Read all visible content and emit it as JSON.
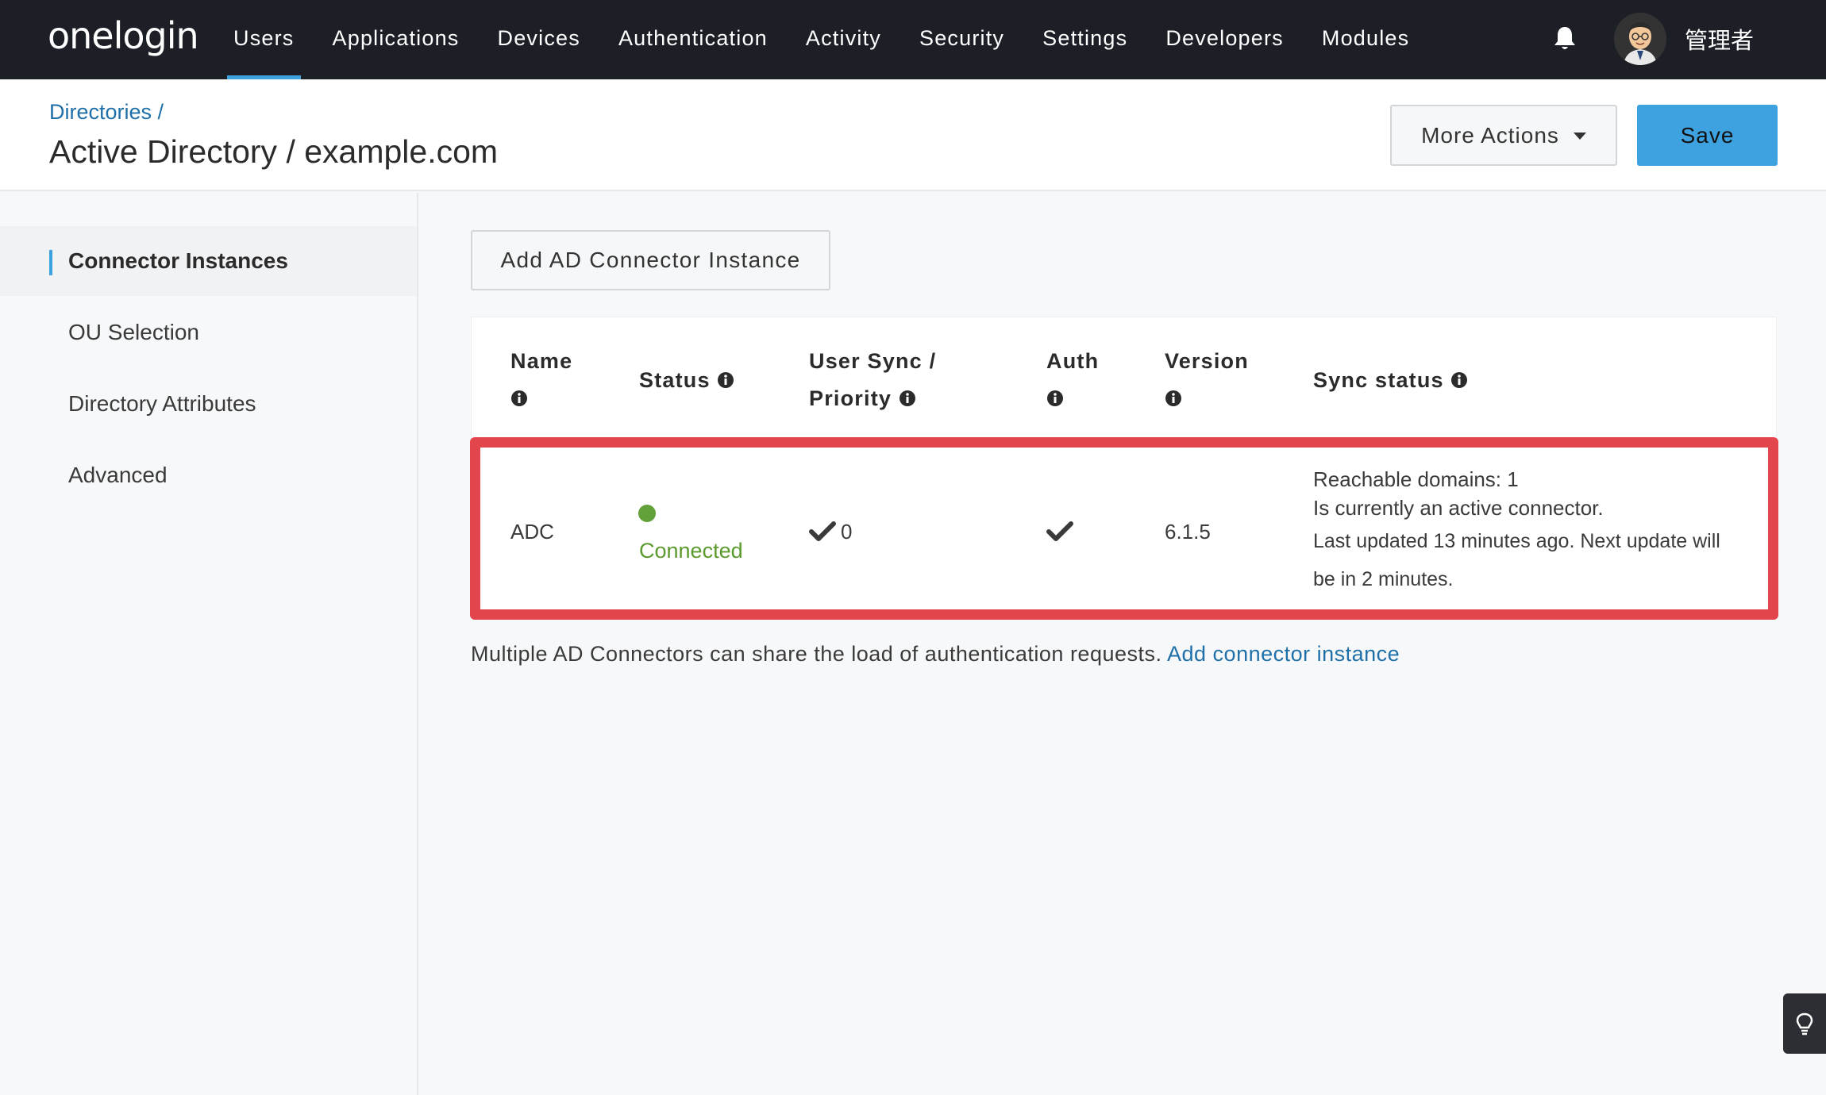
{
  "nav": {
    "logo": "onelogin",
    "items": [
      {
        "label": "Users"
      },
      {
        "label": "Applications"
      },
      {
        "label": "Devices"
      },
      {
        "label": "Authentication"
      },
      {
        "label": "Activity"
      },
      {
        "label": "Security"
      },
      {
        "label": "Settings"
      },
      {
        "label": "Developers"
      },
      {
        "label": "Modules"
      }
    ],
    "active_item": "Users",
    "user_name": "管理者",
    "bell_icon": "bell-icon"
  },
  "header": {
    "breadcrumb": "Directories",
    "breadcrumb_sep": " /",
    "title": "Active Directory / example.com",
    "more_actions_label": "More Actions",
    "save_label": "Save"
  },
  "sidebar": {
    "items": [
      {
        "label": "Connector Instances"
      },
      {
        "label": "OU Selection"
      },
      {
        "label": "Directory Attributes"
      },
      {
        "label": "Advanced"
      }
    ],
    "active_item": "Connector Instances"
  },
  "main": {
    "add_button_label": "Add AD Connector Instance",
    "table": {
      "headers": {
        "name": "Name",
        "status": "Status",
        "user_sync_line1": "User Sync /",
        "user_sync_line2": "Priority",
        "auth": "Auth",
        "version": "Version",
        "sync_status": "Sync status"
      },
      "rows": [
        {
          "name": "ADC",
          "status": "Connected",
          "user_sync_checked": true,
          "priority": "0",
          "auth_checked": true,
          "version": "6.1.5",
          "sync_line1": "Reachable domains: 1",
          "sync_line2": "Is currently an active connector.",
          "sync_line3": "Last updated 13 minutes ago. Next update will",
          "sync_line4": "be in 2 minutes."
        }
      ]
    },
    "footer_text": "Multiple AD Connectors can share the load of authentication requests.",
    "footer_link": "Add connector instance"
  },
  "colors": {
    "nav_bg": "#1c1f26",
    "accent": "#3fa2e0",
    "highlight_border": "#e2454b",
    "connected_green": "#5b9a2d",
    "link_blue": "#1f6fa8"
  }
}
